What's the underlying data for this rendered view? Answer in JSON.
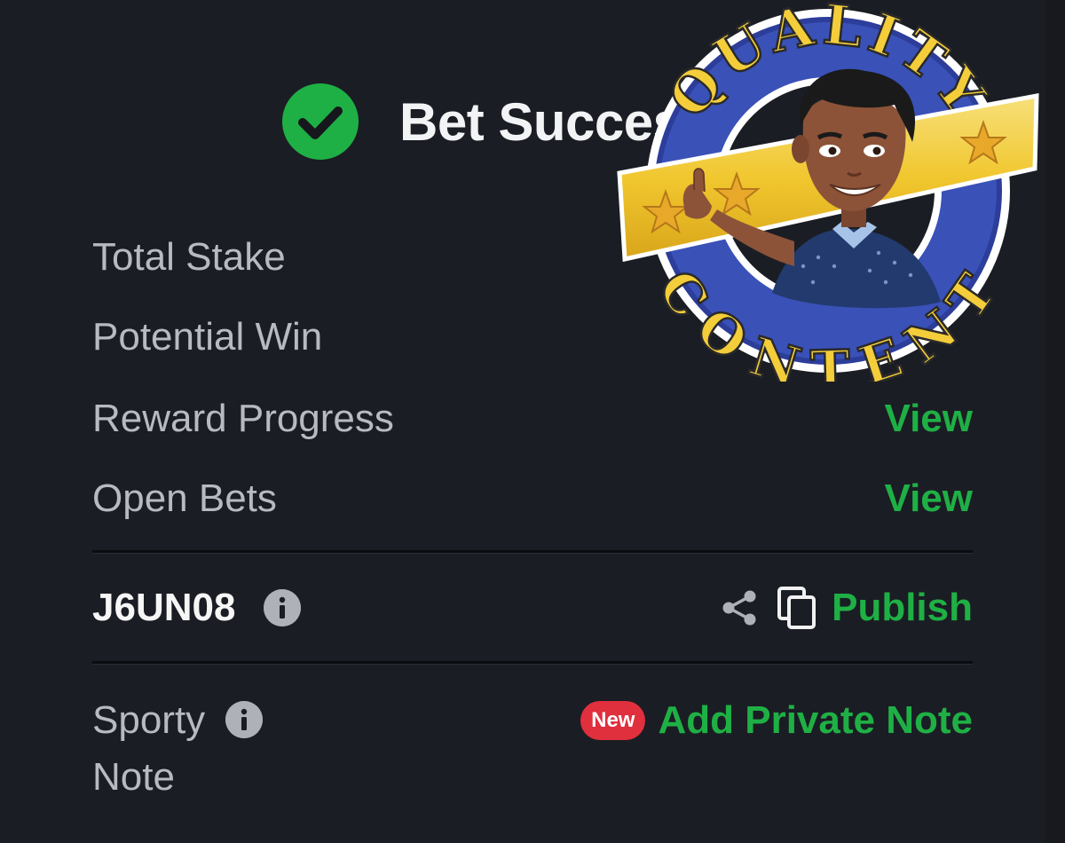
{
  "header": {
    "title": "Bet Successful",
    "status_icon": "check-circle-icon",
    "accent": "#1fb045"
  },
  "summary": {
    "total_stake_label": "Total Stake",
    "potential_win_label": "Potential Win",
    "reward_progress_label": "Reward Progress",
    "reward_progress_action": "View",
    "open_bets_label": "Open Bets",
    "open_bets_action": "View"
  },
  "booking": {
    "code": "J6UN08",
    "info_icon": "info-icon",
    "share_icon": "share-icon",
    "copy_icon": "copy-icon",
    "publish_label": "Publish"
  },
  "note": {
    "label": "Sporty Note",
    "info_icon": "info-icon",
    "new_badge": "New",
    "add_label": "Add Private Note"
  },
  "sticker": {
    "top_text": "QUALITY",
    "bottom_text": "CONTENT"
  }
}
